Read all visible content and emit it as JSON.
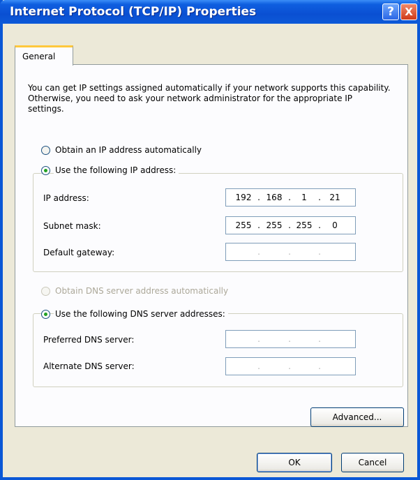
{
  "window": {
    "title": "Internet Protocol (TCP/IP) Properties",
    "help_glyph": "?",
    "close_glyph": "X"
  },
  "tabs": [
    {
      "label": "General"
    }
  ],
  "general": {
    "intro": "You can get IP settings assigned automatically if your network supports this capability. Otherwise, you need to ask your network administrator for the appropriate IP settings.",
    "obtain_ip_auto": {
      "label": "Obtain an IP address automatically",
      "selected": false
    },
    "use_following_ip": {
      "label": "Use the following IP address:",
      "selected": true
    },
    "ip_address": {
      "label": "IP address:",
      "octets": [
        "192",
        "168",
        "1",
        "21"
      ]
    },
    "subnet_mask": {
      "label": "Subnet mask:",
      "octets": [
        "255",
        "255",
        "255",
        "0"
      ]
    },
    "default_gateway": {
      "label": "Default gateway:",
      "octets": [
        "",
        "",
        "",
        ""
      ]
    },
    "obtain_dns_auto": {
      "label": "Obtain DNS server address automatically",
      "selected": false,
      "enabled": false
    },
    "use_following_dns": {
      "label": "Use the following DNS server addresses:",
      "selected": true
    },
    "preferred_dns": {
      "label": "Preferred DNS server:",
      "octets": [
        "",
        "",
        "",
        ""
      ]
    },
    "alternate_dns": {
      "label": "Alternate DNS server:",
      "octets": [
        "",
        "",
        "",
        ""
      ]
    },
    "advanced_label": "Advanced..."
  },
  "footer": {
    "ok_label": "OK",
    "cancel_label": "Cancel"
  },
  "ip_separator": "."
}
